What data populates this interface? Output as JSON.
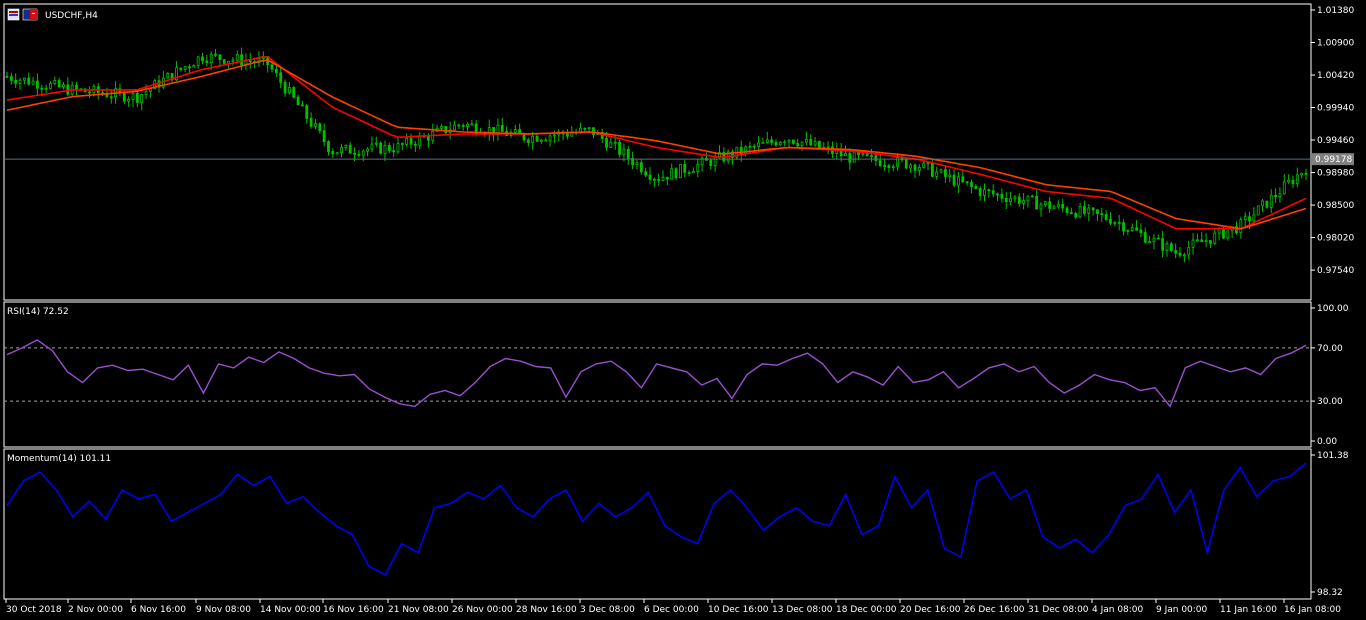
{
  "window": {
    "symbol_title": "USDCHF,H4"
  },
  "colors": {
    "background": "#000000",
    "frame": "#ffffff",
    "candle": "#00c000",
    "ma_fast": "#ff0000",
    "ma_slow": "#ff4000",
    "rsi": "#9a4fd0",
    "momentum": "#0000ff",
    "price_line": "#5a7280",
    "level_line": "#a0a0a0",
    "price_tag_bg": "#808080"
  },
  "icons": [
    "chart-window-icon",
    "currency-flag-icon"
  ],
  "chart_data": [
    {
      "name": "price",
      "type": "candlestick",
      "title": "USDCHF,H4",
      "ylim": [
        0.97128,
        1.0138
      ],
      "y_ticks": [
        "1.01380",
        "1.00900",
        "1.00420",
        "0.99940",
        "0.99460",
        "0.98980",
        "0.98500",
        "0.98020",
        "0.97540"
      ],
      "current_price": "0.99178",
      "candles_close_approx": {
        "x": [
          "30 Oct 2018",
          "2 Nov 00:00",
          "6 Nov 16:00",
          "9 Nov 08:00",
          "14 Nov 00:00",
          "16 Nov 16:00",
          "21 Nov 08:00",
          "26 Nov 00:00",
          "28 Nov 16:00",
          "3 Dec 08:00",
          "6 Dec 00:00",
          "10 Dec 16:00",
          "13 Dec 08:00",
          "18 Dec 00:00",
          "20 Dec 16:00",
          "26 Dec 16:00",
          "31 Dec 08:00",
          "4 Jan 08:00",
          "9 Jan 00:00",
          "11 Jan 16:00",
          "16 Jan 08:00"
        ],
        "values": [
          1.004,
          1.002,
          1.001,
          1.007,
          1.006,
          0.993,
          0.9935,
          0.997,
          0.995,
          0.996,
          0.989,
          0.992,
          0.995,
          0.992,
          0.991,
          0.987,
          0.985,
          0.983,
          0.978,
          0.982,
          0.9905
        ]
      },
      "moving_averages": [
        {
          "values": [
            1.0005,
            1.002,
            1.002,
            1.005,
            1.007,
            0.9995,
            0.995,
            0.9955,
            0.9955,
            0.9958,
            0.9935,
            0.992,
            0.9935,
            0.993,
            0.9918,
            0.9895,
            0.987,
            0.986,
            0.9815,
            0.9815,
            0.986
          ]
        },
        {
          "values": [
            0.999,
            1.001,
            1.0018,
            1.004,
            1.0065,
            1.001,
            0.9965,
            0.9958,
            0.9955,
            0.9958,
            0.9945,
            0.9925,
            0.9935,
            0.9932,
            0.9922,
            0.9905,
            0.988,
            0.987,
            0.983,
            0.9815,
            0.9845
          ]
        }
      ]
    },
    {
      "name": "rsi",
      "type": "line",
      "title": "RSI(14) 72.52",
      "ylim": [
        0,
        100
      ],
      "y_ticks": [
        "100.00",
        "70.00",
        "30.00",
        "0.00"
      ],
      "levels": [
        70,
        30
      ],
      "series": [
        {
          "values": [
            65,
            70,
            76,
            68,
            52,
            44,
            55,
            57,
            53,
            54,
            50,
            46,
            57,
            36,
            58,
            55,
            63,
            59,
            67,
            62,
            55,
            51,
            49,
            50,
            39,
            33,
            28,
            26,
            35,
            38,
            34,
            44,
            56,
            62,
            60,
            56,
            55,
            33,
            52,
            58,
            60,
            52,
            40,
            58,
            55,
            52,
            42,
            47,
            32,
            50,
            58,
            57,
            62,
            66,
            58,
            44,
            52,
            48,
            42,
            56,
            44,
            46,
            52,
            40,
            47,
            55,
            58,
            52,
            56,
            44,
            36,
            42,
            50,
            46,
            44,
            38,
            40,
            26,
            55,
            60,
            56,
            52,
            55,
            50,
            62,
            66,
            72
          ]
        }
      ]
    },
    {
      "name": "momentum",
      "type": "line",
      "title": "Momentum(14) 101.11",
      "ylim": [
        98.32,
        101.38
      ],
      "y_ticks": [
        "101.38",
        "98.32"
      ],
      "series": [
        {
          "values": [
            100.25,
            100.8,
            101.0,
            100.6,
            100.0,
            100.35,
            99.95,
            100.6,
            100.4,
            100.5,
            99.9,
            100.1,
            100.3,
            100.5,
            100.95,
            100.7,
            100.9,
            100.3,
            100.45,
            100.1,
            99.8,
            99.6,
            98.9,
            98.7,
            99.4,
            99.2,
            100.2,
            100.3,
            100.55,
            100.4,
            100.7,
            100.2,
            100.0,
            100.4,
            100.6,
            99.9,
            100.3,
            100.0,
            100.2,
            100.55,
            99.8,
            99.55,
            99.4,
            100.3,
            100.6,
            100.2,
            99.7,
            100.0,
            100.2,
            99.9,
            99.8,
            100.5,
            99.6,
            99.8,
            100.9,
            100.2,
            100.6,
            99.3,
            99.1,
            100.8,
            101.0,
            100.4,
            100.6,
            99.55,
            99.3,
            99.5,
            99.2,
            99.6,
            100.25,
            100.4,
            100.95,
            100.1,
            100.6,
            99.2,
            100.6,
            101.1,
            100.45,
            100.8,
            100.9,
            101.2
          ]
        }
      ]
    }
  ],
  "time_axis": {
    "labels": [
      "30 Oct 2018",
      "2 Nov 00:00",
      "6 Nov 16:00",
      "9 Nov 08:00",
      "14 Nov 00:00",
      "16 Nov 16:00",
      "21 Nov 08:00",
      "26 Nov 00:00",
      "28 Nov 16:00",
      "3 Dec 08:00",
      "6 Dec 00:00",
      "10 Dec 16:00",
      "13 Dec 08:00",
      "18 Dec 00:00",
      "20 Dec 16:00",
      "26 Dec 16:00",
      "31 Dec 08:00",
      "4 Jan 08:00",
      "9 Jan 00:00",
      "11 Jan 16:00",
      "16 Jan 08:00"
    ]
  }
}
